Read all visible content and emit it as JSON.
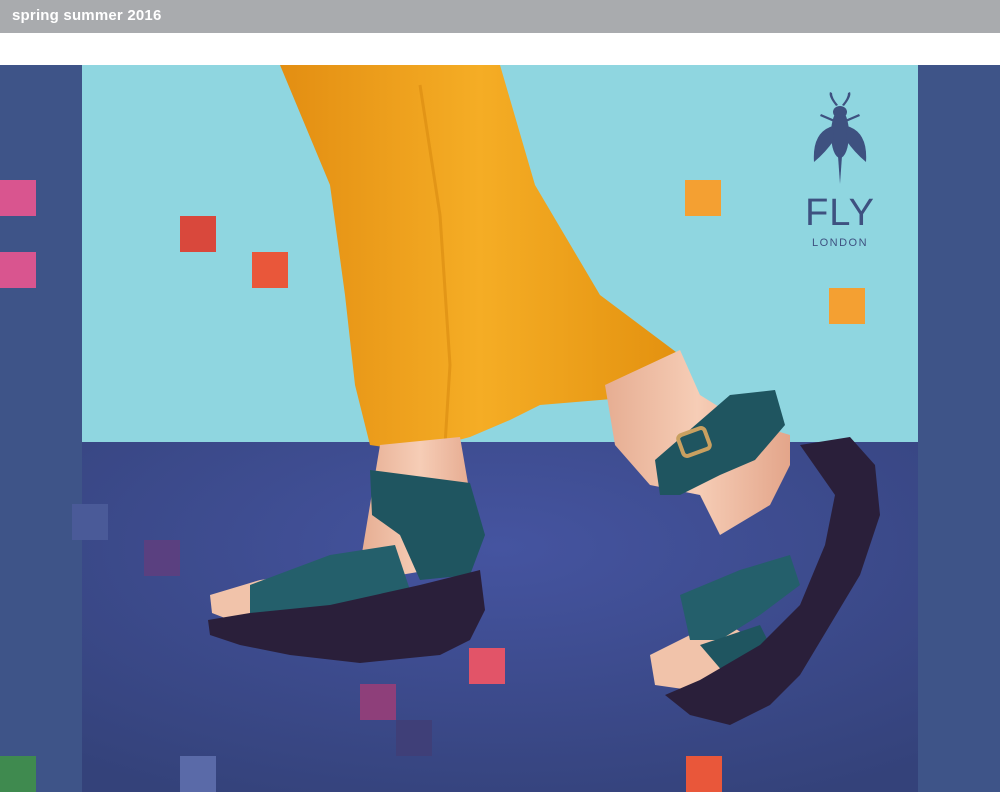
{
  "header": {
    "title": "spring summer 2016"
  },
  "brand": {
    "wordmark": "FLY",
    "sub": "LONDON",
    "icon": "fly-insect-icon"
  },
  "colors": {
    "topbar": "#a9abae",
    "side_panel": "#3e5488",
    "sky": "#8fd6e0",
    "floor": "#3b4a88",
    "trousers": "#efa21c",
    "sandal": "#1f5560",
    "sole": "#2a1f3a",
    "skin": "#f1c3aa"
  }
}
